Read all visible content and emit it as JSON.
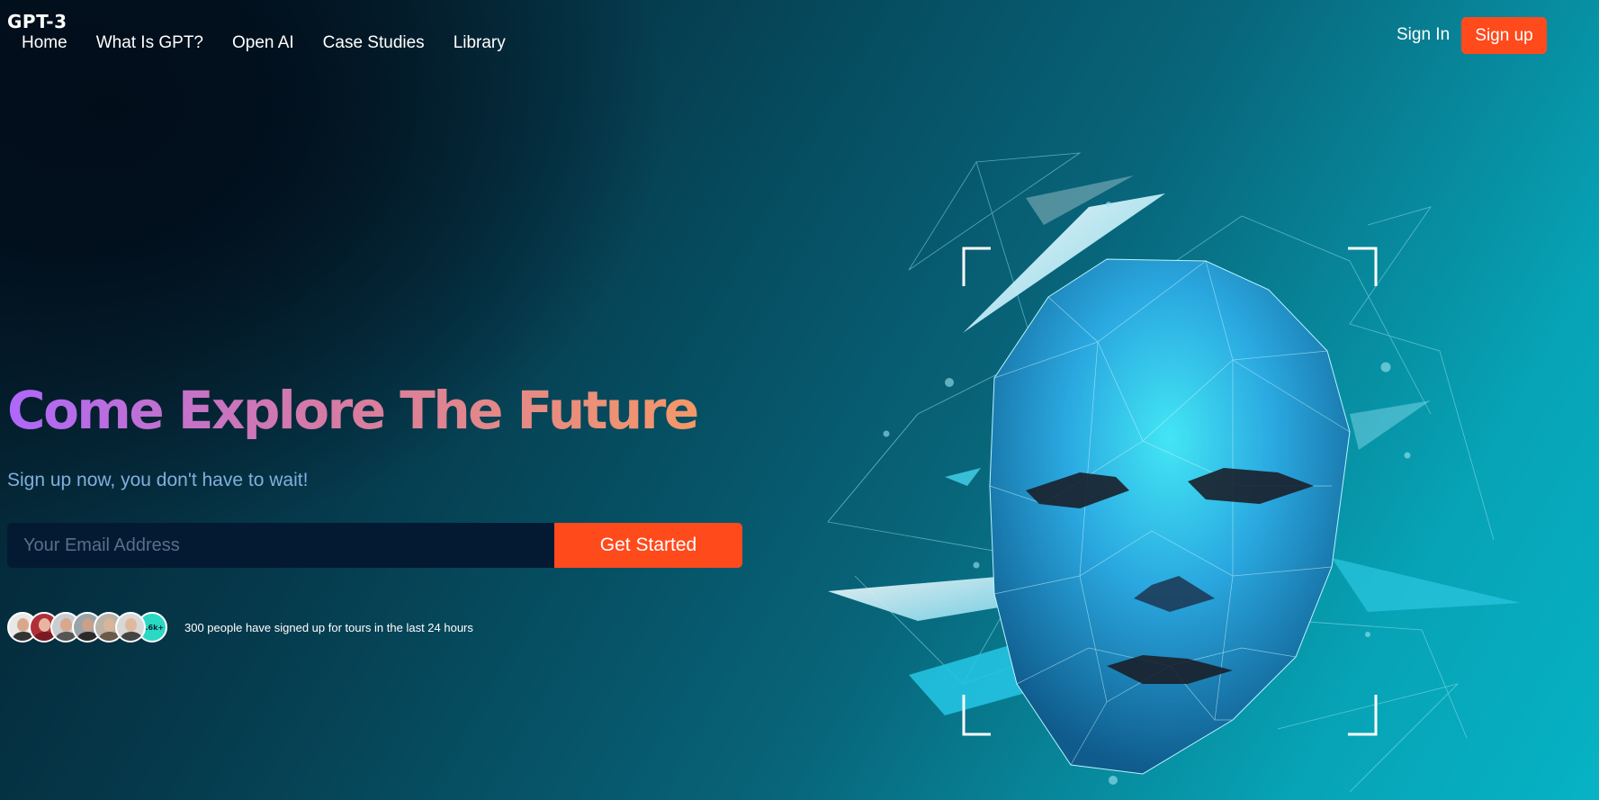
{
  "brand": {
    "logo": "GPT-3"
  },
  "nav": {
    "items": [
      "Home",
      "What Is GPT?",
      "Open AI",
      "Case Studies",
      "Library"
    ]
  },
  "auth": {
    "sign_in": "Sign In",
    "sign_up": "Sign up"
  },
  "hero": {
    "headline": "Come Explore The Future",
    "subtitle": "Sign up now, you don't have to wait!",
    "email_placeholder": "Your Email Address",
    "cta_label": "Get Started",
    "signup_count_badge": "1.6k+",
    "signup_note": "300 people have signed up for tours in the last 24 hours"
  },
  "colors": {
    "accent": "#ff4a1c",
    "headline_gradient_start": "#ae67fa",
    "headline_gradient_end": "#f49867",
    "subtitle": "#81afdd",
    "badge": "#2ad8c4"
  },
  "icons": [
    "polygon-face-illustration",
    "avatar-icon"
  ]
}
